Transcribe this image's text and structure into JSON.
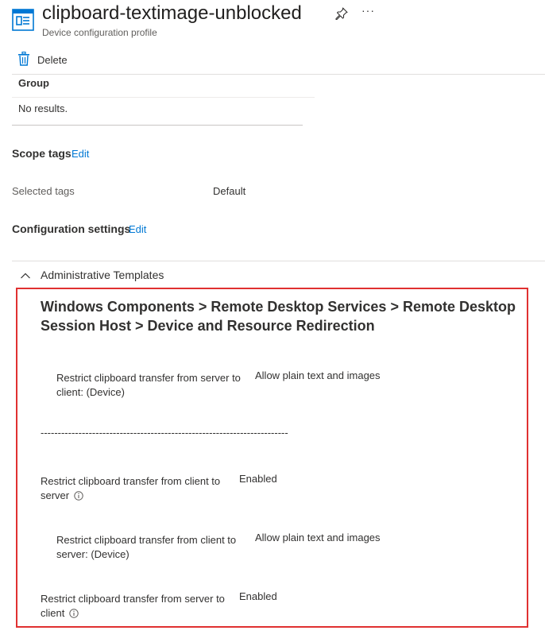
{
  "header": {
    "title": "clipboard-textimage-unblocked",
    "subtitle": "Device configuration profile",
    "icon": "device-configuration-icon",
    "pin_icon": "pin-icon",
    "more_label": "···"
  },
  "commands": {
    "delete_label": "Delete",
    "delete_icon": "trash-icon"
  },
  "group_table": {
    "header": "Group",
    "empty_text": "No results."
  },
  "scope_tags": {
    "heading": "Scope tags",
    "edit_label": "Edit",
    "selected_label": "Selected tags",
    "selected_value": "Default"
  },
  "configuration": {
    "heading": "Configuration settings",
    "edit_label": "Edit",
    "accordion_title": "Administrative Templates",
    "accordion_icon": "chevron-up-icon",
    "path_heading": "Windows Components > Remote Desktop Services > Remote Desktop Session Host > Device and Resource Redirection",
    "separator": "------------------------------------------------------------------------",
    "settings": [
      {
        "label": "Restrict clipboard transfer from server to client: (Device)",
        "value": "Allow plain text and images"
      },
      {
        "label": "Restrict clipboard transfer from client to server",
        "value": "Enabled",
        "info_icon": "info-icon"
      },
      {
        "label": "Restrict clipboard transfer from client to server: (Device)",
        "value": "Allow plain text and images"
      },
      {
        "label": "Restrict clipboard transfer from server to client",
        "value": "Enabled",
        "info_icon": "info-icon"
      }
    ]
  },
  "colors": {
    "accent": "#0078d4",
    "highlight_border": "#e03131",
    "text": "#323130"
  }
}
